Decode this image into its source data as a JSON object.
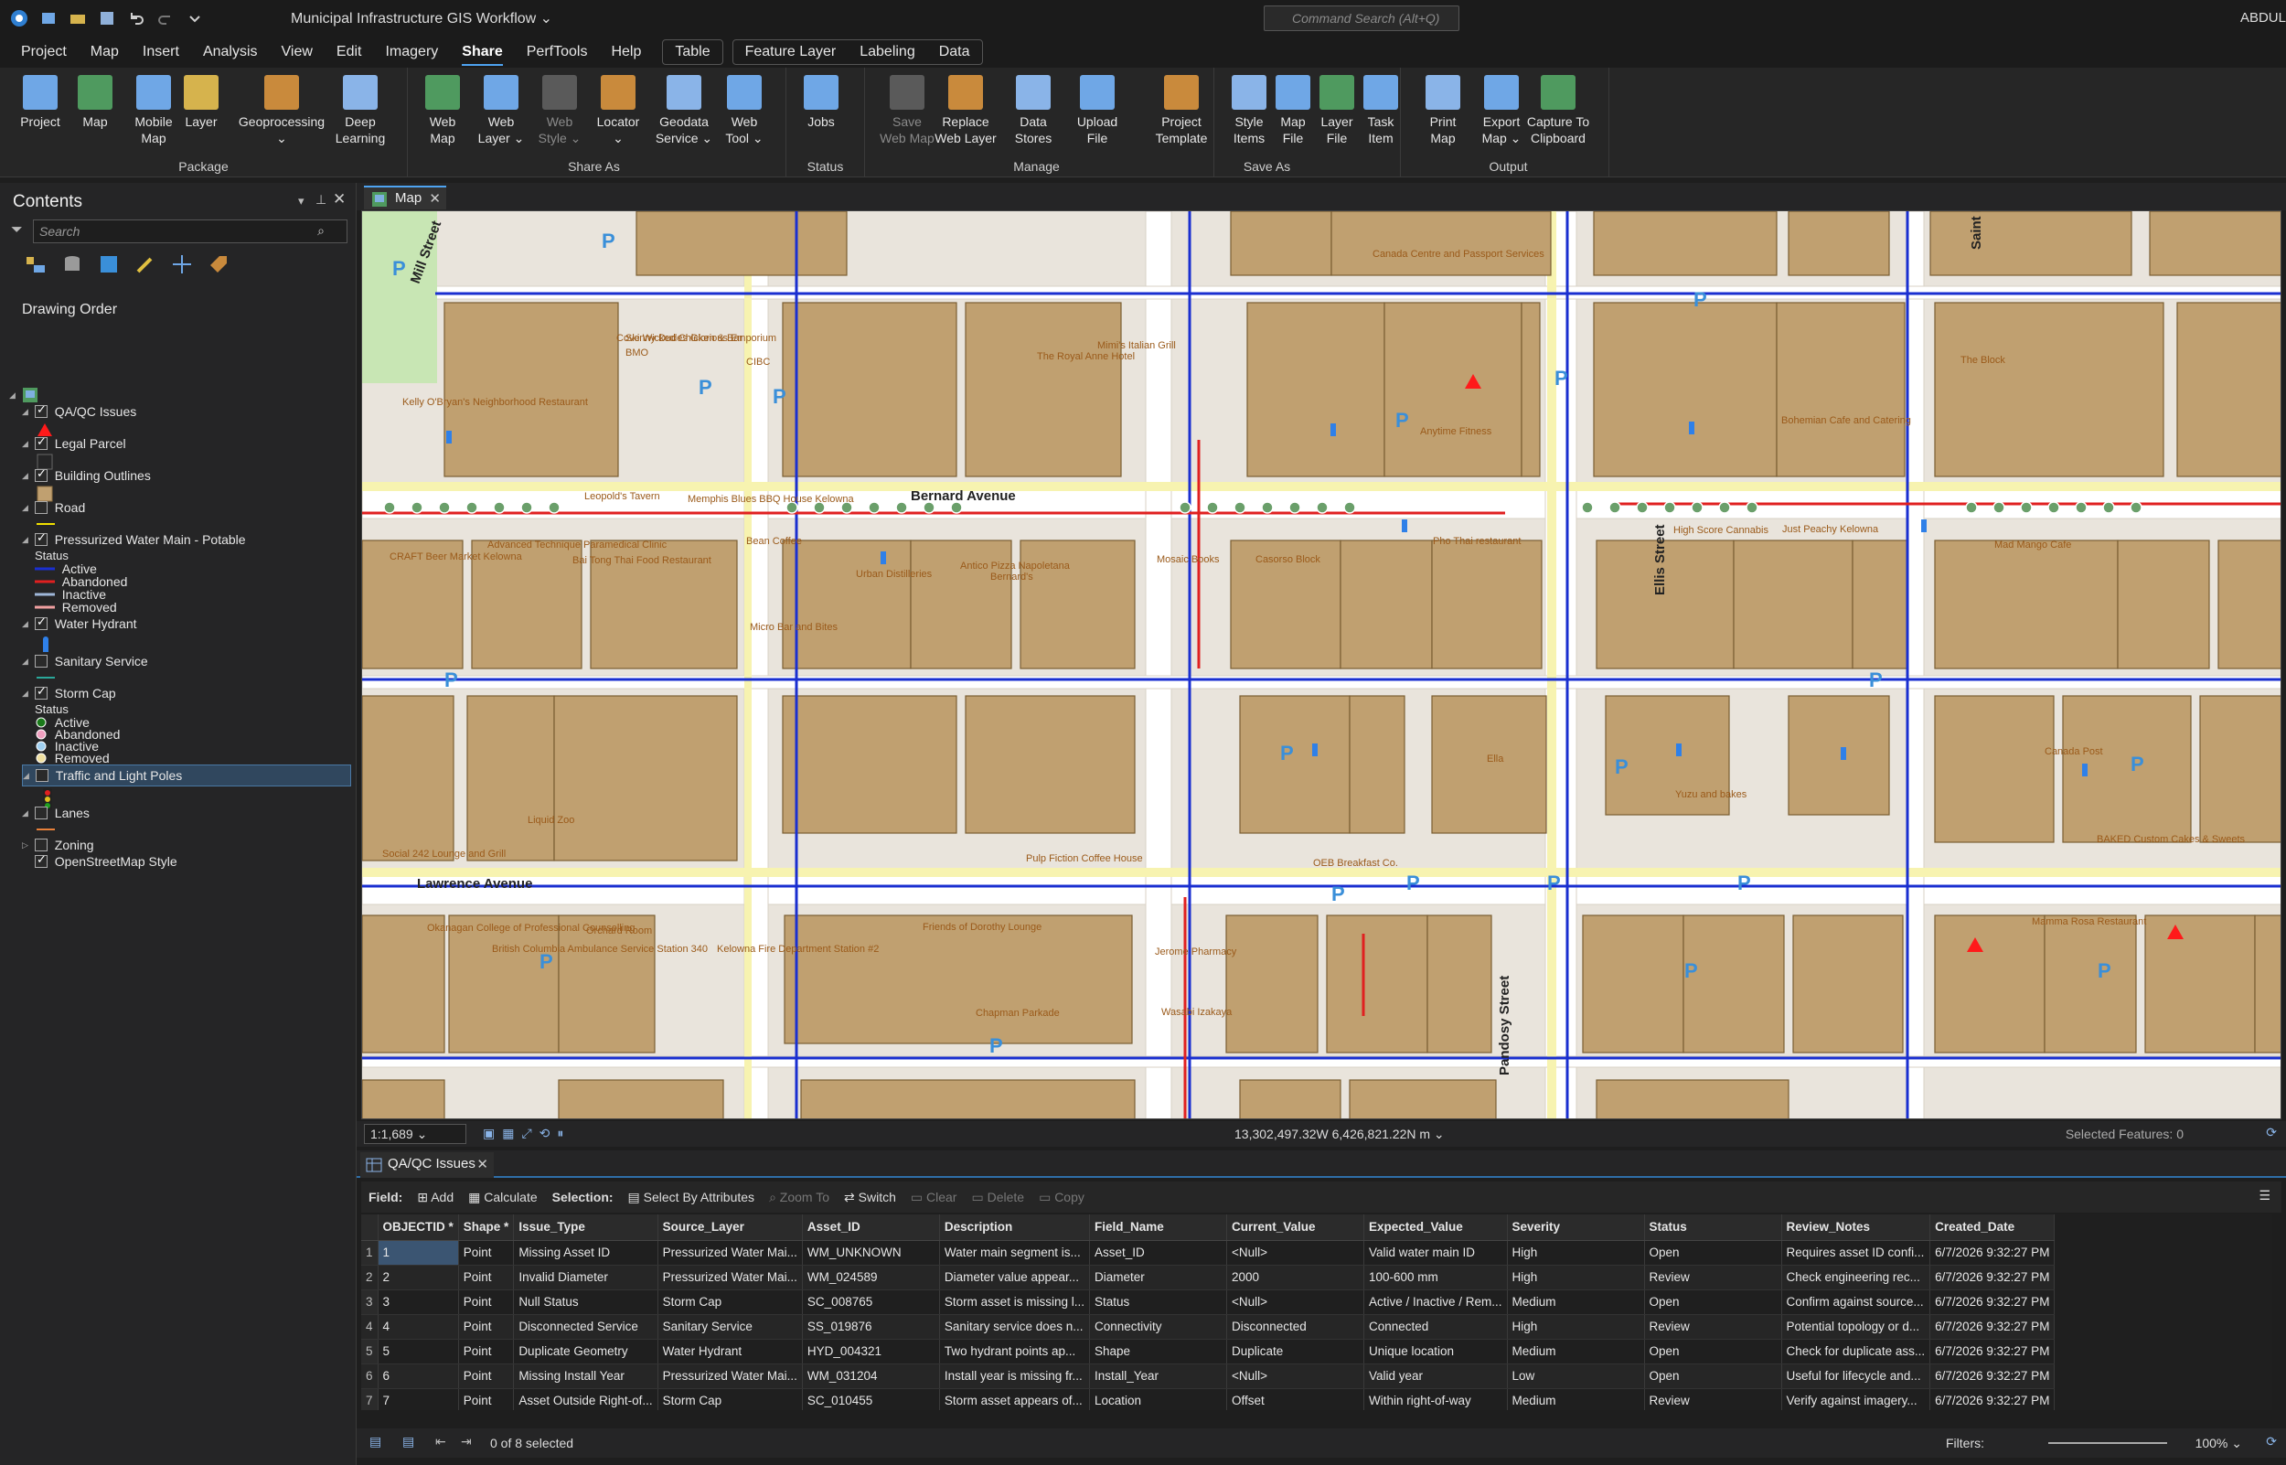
{
  "app": {
    "title": "Municipal Infrastructure GIS Workflow",
    "command_search_placeholder": "Command Search (Alt+Q)",
    "user": "ABDUL"
  },
  "menu": {
    "items": [
      "Project",
      "Map",
      "Insert",
      "Analysis",
      "View",
      "Edit",
      "Imagery",
      "Share",
      "PerfTools",
      "Help"
    ],
    "active": "Share",
    "contextual": [
      [
        "Table"
      ],
      [
        "Feature Layer",
        "Labeling",
        "Data"
      ]
    ]
  },
  "ribbon": {
    "groups": [
      {
        "label": "Package",
        "buttons": [
          {
            "l1": "Project",
            "l2": ""
          },
          {
            "l1": "Map",
            "l2": ""
          },
          {
            "l1": "Mobile",
            "l2": "Map"
          },
          {
            "l1": "Layer",
            "l2": ""
          },
          {
            "l1": "Geoprocessing",
            "l2": "⌄"
          },
          {
            "l1": "Deep",
            "l2": "Learning"
          }
        ]
      },
      {
        "label": "Share As",
        "buttons": [
          {
            "l1": "Web",
            "l2": "Map"
          },
          {
            "l1": "Web",
            "l2": "Layer ⌄"
          },
          {
            "l1": "Web",
            "l2": "Style ⌄"
          },
          {
            "l1": "Locator",
            "l2": "⌄"
          },
          {
            "l1": "Geodata",
            "l2": "Service ⌄"
          },
          {
            "l1": "Web",
            "l2": "Tool ⌄"
          }
        ]
      },
      {
        "label": "Status",
        "buttons": [
          {
            "l1": "Jobs",
            "l2": ""
          }
        ]
      },
      {
        "label": "Manage",
        "buttons": [
          {
            "l1": "Save",
            "l2": "Web Map"
          },
          {
            "l1": "Replace",
            "l2": "Web Layer"
          },
          {
            "l1": "Data",
            "l2": "Stores"
          },
          {
            "l1": "Upload",
            "l2": "File"
          }
        ]
      },
      {
        "label": "Save As",
        "buttons": [
          {
            "l1": "Project",
            "l2": "Template"
          },
          {
            "l1": "Style",
            "l2": "Items"
          },
          {
            "l1": "Map",
            "l2": "File"
          },
          {
            "l1": "Layer",
            "l2": "File"
          },
          {
            "l1": "Task",
            "l2": "Item"
          }
        ]
      },
      {
        "label": "Output",
        "buttons": [
          {
            "l1": "Print",
            "l2": "Map"
          },
          {
            "l1": "Export",
            "l2": "Map ⌄"
          },
          {
            "l1": "Capture To",
            "l2": "Clipboard"
          }
        ]
      }
    ]
  },
  "contents": {
    "title": "Contents",
    "search_placeholder": "Search",
    "drawing_order": "Drawing Order",
    "map_node": "Map",
    "layers": {
      "qa": "QA/QC Issues",
      "parcel": "Legal Parcel",
      "buildings": "Building Outlines",
      "road": "Road",
      "water_main": "Pressurized Water Main - Potable",
      "status_label": "Status",
      "wm_status": [
        "Active",
        "Abandoned",
        "Inactive",
        "Removed"
      ],
      "hydrant": "Water Hydrant",
      "sanitary": "Sanitary Service",
      "storm": "Storm Cap",
      "storm_status_label": "Status",
      "sc_status": [
        "Active",
        "Abandoned",
        "Inactive",
        "Removed"
      ],
      "poles": "Traffic and Light Poles",
      "lanes": "Lanes",
      "zoning": "Zoning",
      "osm": "OpenStreetMap Style"
    }
  },
  "map": {
    "tab": "Map",
    "scale": "1:1,689",
    "coordinates": "13,302,497.32W 6,426,821.22N m",
    "selected_features": "Selected Features: 0",
    "streets": [
      "Mill Street",
      "Bernard Avenue",
      "Lawrence Avenue",
      "Ellis Street",
      "Pandosy Street",
      "Saint Paul"
    ],
    "places": [
      "Canada Centre and Passport Services",
      "Skinny Dudes Glorious Emporium",
      "CIBC",
      "The Royal Anne Hotel",
      "Mimi's Italian Grill",
      "BMO",
      "Cove Wicked Chicken & Bar",
      "Kelly O'Bryan's Neighborhood Restaurant",
      "Anytime Fitness",
      "Bohemian Cafe and Catering",
      "The Block",
      "Leopold's Tavern",
      "Memphis Blues BBQ House Kelowna",
      "Bean Coffee",
      "CRAFT Beer Market Kelowna",
      "Advanced Technique Paramedical Clinic",
      "Bai Tong Thai Food Restaurant",
      "Micro Bar and Bites",
      "Urban Distilleries",
      "Antico Pizza Napoletana",
      "Bernard's",
      "Mosaic Books",
      "Casorso Block",
      "Pho Thai restaurant",
      "High Score Cannabis",
      "Just Peachy Kelowna",
      "Mad Mango Cafe",
      "Liquid Zoo",
      "Ella",
      "Yuzu and bakes",
      "Canada Post",
      "Social 242 Lounge and Grill",
      "Pulp Fiction Coffee House",
      "OEB Breakfast Co.",
      "Okanagan College of Professional Counselling",
      "British Columbia Ambulance Service Station 340",
      "Orchard Room",
      "Kelowna Fire Department Station #2",
      "Friends of Dorothy Lounge",
      "Chapman Parkade",
      "Jerome Pharmacy",
      "Wasabi Izakaya",
      "BAKED Custom Cakes & Sweets",
      "Mamma Rosa Restaurant"
    ]
  },
  "table": {
    "tab": "QA/QC Issues",
    "toolbar": {
      "field": "Field:",
      "add": "Add",
      "calculate": "Calculate",
      "selection": "Selection:",
      "select_by_attr": "Select By Attributes",
      "zoom_to": "Zoom To",
      "switch": "Switch",
      "clear": "Clear",
      "delete": "Delete",
      "copy": "Copy"
    },
    "columns": [
      "OBJECTID *",
      "Shape *",
      "Issue_Type",
      "Source_Layer",
      "Asset_ID",
      "Description",
      "Field_Name",
      "Current_Value",
      "Expected_Value",
      "Severity",
      "Status",
      "Review_Notes",
      "Created_Date"
    ],
    "rows": [
      [
        "1",
        "1",
        "Point",
        "Missing Asset ID",
        "Pressurized Water Mai...",
        "WM_UNKNOWN",
        "Water main segment is...",
        "Asset_ID",
        "<Null>",
        "Valid water main ID",
        "High",
        "Open",
        "Requires asset ID confi...",
        "6/7/2026 9:32:27 PM"
      ],
      [
        "2",
        "2",
        "Point",
        "Invalid Diameter",
        "Pressurized Water Mai...",
        "WM_024589",
        "Diameter value appear...",
        "Diameter",
        "2000",
        "100-600 mm",
        "High",
        "Review",
        "Check engineering rec...",
        "6/7/2026 9:32:27 PM"
      ],
      [
        "3",
        "3",
        "Point",
        "Null Status",
        "Storm Cap",
        "SC_008765",
        "Storm asset is missing l...",
        "Status",
        "<Null>",
        "Active / Inactive / Rem...",
        "Medium",
        "Open",
        "Confirm against source...",
        "6/7/2026 9:32:27 PM"
      ],
      [
        "4",
        "4",
        "Point",
        "Disconnected Service",
        "Sanitary Service",
        "SS_019876",
        "Sanitary service does n...",
        "Connectivity",
        "Disconnected",
        "Connected",
        "High",
        "Review",
        "Potential topology or d...",
        "6/7/2026 9:32:27 PM"
      ],
      [
        "5",
        "5",
        "Point",
        "Duplicate Geometry",
        "Water Hydrant",
        "HYD_004321",
        "Two hydrant points ap...",
        "Shape",
        "Duplicate",
        "Unique location",
        "Medium",
        "Open",
        "Check for duplicate ass...",
        "6/7/2026 9:32:27 PM"
      ],
      [
        "6",
        "6",
        "Point",
        "Missing Install Year",
        "Pressurized Water Mai...",
        "WM_031204",
        "Install year is missing fr...",
        "Install_Year",
        "<Null>",
        "Valid year",
        "Low",
        "Open",
        "Useful for lifecycle and...",
        "6/7/2026 9:32:27 PM"
      ],
      [
        "7",
        "7",
        "Point",
        "Asset Outside Right-of...",
        "Storm Cap",
        "SC_010455",
        "Storm asset appears of...",
        "Location",
        "Offset",
        "Within right-of-way",
        "Medium",
        "Review",
        "Verify against imagery...",
        "6/7/2026 9:32:27 PM"
      ]
    ],
    "selection_count": "0 of 8 selected",
    "filters_label": "Filters:",
    "zoom": "100%"
  },
  "colors": {
    "accent": "#4ea3f1",
    "building": "#c0a070",
    "water_active": "#1a2fd0",
    "water_abandoned": "#e02020",
    "water_inactive": "#9fb7d9",
    "water_removed": "#f0a0a0",
    "qa_marker": "#ff1a1a"
  }
}
